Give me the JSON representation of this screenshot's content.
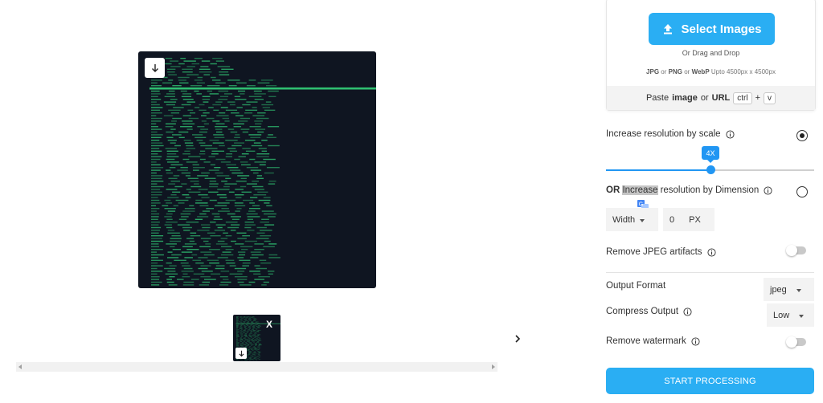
{
  "upload": {
    "select_label": "Select Images",
    "drag_text": "Or Drag and Drop",
    "formats": {
      "jpg": "JPG",
      "or1": "or",
      "png": "PNG",
      "or2": "or",
      "webp": "WebP",
      "limit": "Upto 4500px x 4500px"
    },
    "paste": {
      "prefix": "Paste",
      "image": "image",
      "or": "or",
      "url": "URL",
      "key_ctrl": "ctrl",
      "plus": "+",
      "key_v": "v"
    }
  },
  "scale": {
    "label": "Increase resolution by scale",
    "value_label": "4X",
    "fraction": 0.5,
    "selected": true
  },
  "dimension": {
    "or_label": "OR",
    "word_highlight": "Increase",
    "label_rest": "resolution by Dimension",
    "selected": false,
    "select_value": "Width",
    "input_value": "0",
    "unit": "PX"
  },
  "jpeg_artifacts": {
    "label": "Remove JPEG artifacts",
    "enabled": false
  },
  "output_format": {
    "label": "Output Format",
    "value": "jpeg"
  },
  "compress": {
    "label": "Compress Output",
    "value": "Low"
  },
  "watermark": {
    "label": "Remove watermark",
    "enabled": false
  },
  "start_label": "START PROCESSING",
  "thumbnail": {
    "close_label": "X"
  },
  "colors": {
    "accent": "#2aaef3",
    "slider": "#2196f3",
    "terminal_bg": "#0f1521",
    "terminal_text": "#2fbf71"
  }
}
